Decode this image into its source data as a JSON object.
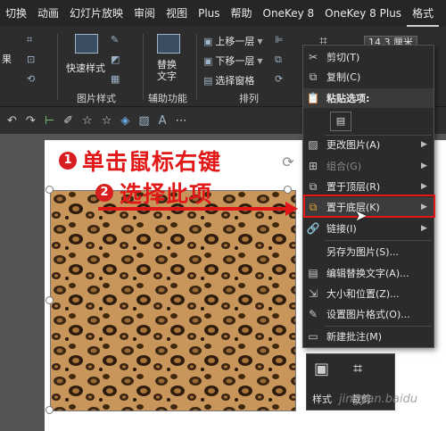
{
  "menubar": {
    "tabs": [
      "切换",
      "动画",
      "幻灯片放映",
      "审阅",
      "视图",
      "Plus",
      "帮助",
      "OneKey 8",
      "OneKey 8 Plus",
      "格式"
    ]
  },
  "ribbon": {
    "left_label": "果",
    "quick_styles": "快速样式",
    "picture_styles": "图片样式",
    "replace_text": "替换\n文字",
    "accessibility": "辅助功能",
    "bring_forward": "上移一层",
    "send_backward": "下移一层",
    "selection_pane": "选择窗格",
    "arrange": "排列",
    "size_value": "14.3 厘米"
  },
  "annotations": {
    "step1_num": "1",
    "step1_text": "单击鼠标右键",
    "step2_num": "2",
    "step2_text": "选择此项"
  },
  "context_menu": {
    "items": [
      {
        "icon": "scissors-icon",
        "label": "剪切(T)",
        "submenu": false,
        "disabled": false
      },
      {
        "icon": "copy-icon",
        "label": "复制(C)",
        "submenu": false,
        "disabled": false
      },
      {
        "icon": "paste-icon",
        "label": "粘贴选项:",
        "submenu": false,
        "disabled": false
      },
      {
        "icon": "change-picture-icon",
        "label": "更改图片(A)",
        "submenu": true,
        "disabled": false
      },
      {
        "icon": "group-icon",
        "label": "组合(G)",
        "submenu": true,
        "disabled": true
      },
      {
        "icon": "bring-to-front-icon",
        "label": "置于顶层(R)",
        "submenu": true,
        "disabled": false
      },
      {
        "icon": "send-to-back-icon",
        "label": "置于底层(K)",
        "submenu": true,
        "disabled": false
      },
      {
        "icon": "link-icon",
        "label": "链接(I)",
        "submenu": true,
        "disabled": false
      },
      {
        "icon": "",
        "label": "另存为图片(S)...",
        "submenu": false,
        "disabled": false
      },
      {
        "icon": "alt-text-icon",
        "label": "编辑替换文字(A)...",
        "submenu": false,
        "disabled": false
      },
      {
        "icon": "size-position-icon",
        "label": "大小和位置(Z)...",
        "submenu": false,
        "disabled": false
      },
      {
        "icon": "format-picture-icon",
        "label": "设置图片格式(O)...",
        "submenu": false,
        "disabled": false
      },
      {
        "icon": "new-comment-icon",
        "label": "新建批注(M)",
        "submenu": false,
        "disabled": false
      }
    ]
  },
  "mini_toolbar": {
    "style_label": "样式",
    "crop_label": "裁剪"
  },
  "watermark": "jingyan.baidu"
}
